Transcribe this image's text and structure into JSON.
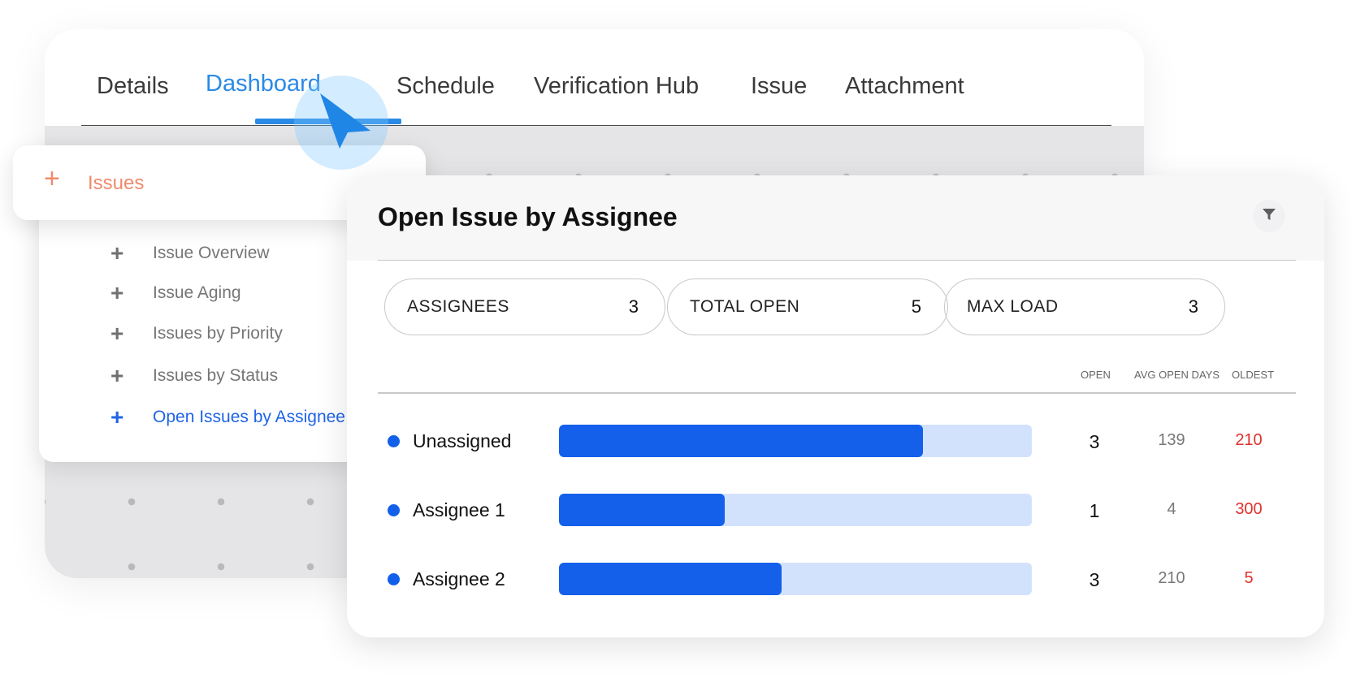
{
  "tabs": [
    {
      "label": "Details",
      "active": false
    },
    {
      "label": "Dashboard",
      "active": true
    },
    {
      "label": "Schedule",
      "active": false
    },
    {
      "label": "Verification Hub",
      "active": false
    },
    {
      "label": "Issue",
      "active": false
    },
    {
      "label": "Attachment",
      "active": false
    }
  ],
  "sidebar": {
    "header": {
      "label": "Issues",
      "icon": "plus-icon",
      "color": "#ef8a6b"
    },
    "items": [
      {
        "label": "Issue Overview",
        "active": false
      },
      {
        "label": "Issue Aging",
        "active": false
      },
      {
        "label": "Issues by Priority",
        "active": false
      },
      {
        "label": "Issues by Status",
        "active": false
      },
      {
        "label": "Open Issues by Assignee",
        "active": true
      }
    ]
  },
  "panel": {
    "title": "Open Issue by Assignee",
    "filter_icon": "filter-icon",
    "stats": [
      {
        "label": "ASSIGNEES",
        "value": "3"
      },
      {
        "label": "TOTAL OPEN",
        "value": "5"
      },
      {
        "label": "MAX LOAD",
        "value": "3"
      }
    ],
    "columns": {
      "open": "OPEN",
      "avg": "AVG OPEN DAYS",
      "oldest": "OLDEST"
    },
    "rows": [
      {
        "name": "Unassigned",
        "open": "3",
        "avg": "139",
        "oldest": "210",
        "bar_fraction": 0.77
      },
      {
        "name": "Assignee 1",
        "open": "1",
        "avg": "4",
        "oldest": "300",
        "bar_fraction": 0.35
      },
      {
        "name": "Assignee 2",
        "open": "3",
        "avg": "210",
        "oldest": "5",
        "bar_fraction": 0.47
      }
    ]
  },
  "colors": {
    "accent": "#2a8ae6",
    "bar": "#1460ea",
    "bar_track": "#d3e2fc",
    "oldest": "#e0302b"
  }
}
